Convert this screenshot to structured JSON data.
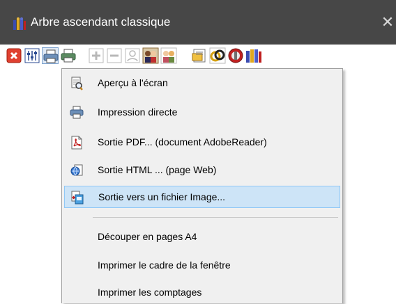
{
  "window": {
    "title": "Arbre ascendant classique",
    "close_glyph": "✕",
    "title_icon": "family-tree-icon"
  },
  "toolbar": {
    "buttons": [
      {
        "icon": "close-red-icon"
      },
      {
        "icon": "settings-sliders-icon"
      },
      {
        "icon": "print-icon",
        "pressed": true
      },
      {
        "icon": "print-preview-icon"
      },
      {
        "icon": "zoom-in-icon"
      },
      {
        "icon": "zoom-out-icon"
      },
      {
        "icon": "person-outline-icon"
      },
      {
        "icon": "couple-icon"
      },
      {
        "icon": "family-icon"
      },
      {
        "icon": "document-icon"
      },
      {
        "icon": "rings-icon"
      },
      {
        "icon": "gauge-icon"
      },
      {
        "icon": "tree-icon"
      }
    ]
  },
  "menu": {
    "items": [
      {
        "label": "Aperçu à l'écran",
        "icon": "preview-icon"
      },
      {
        "label": "Impression directe",
        "icon": "printer-icon"
      },
      {
        "label": "Sortie PDF...  (document AdobeReader)",
        "icon": "pdf-icon"
      },
      {
        "label": "Sortie HTML ...  (page Web)",
        "icon": "html-icon"
      },
      {
        "label": "Sortie vers un fichier Image...",
        "icon": "image-file-icon",
        "highlighted": true
      },
      {
        "label": "Découper en pages A4"
      },
      {
        "label": "Imprimer le cadre de la fenêtre"
      },
      {
        "label": "Imprimer les comptages"
      }
    ]
  },
  "colors": {
    "titlebar": "#474747",
    "menu_bg": "#f0f0f0",
    "highlight_bg": "#cde4f7",
    "highlight_border": "#90c8f6"
  }
}
